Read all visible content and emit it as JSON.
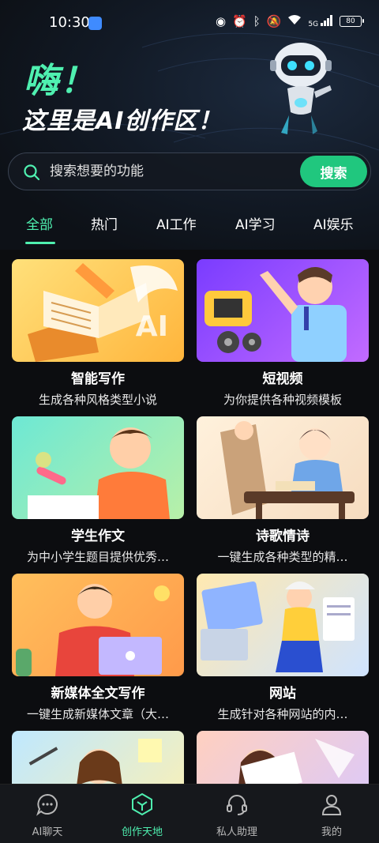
{
  "status_bar": {
    "time": "10:30",
    "network": "5G",
    "battery": "80"
  },
  "hero": {
    "title": "嗨！",
    "subtitle": "这里是AI创作区！"
  },
  "search": {
    "placeholder": "搜索想要的功能",
    "button_label": "搜索"
  },
  "tabs": [
    {
      "label": "全部",
      "active": true
    },
    {
      "label": "热门",
      "active": false
    },
    {
      "label": "AI工作",
      "active": false
    },
    {
      "label": "AI学习",
      "active": false
    },
    {
      "label": "AI娱乐",
      "active": false
    }
  ],
  "cards": [
    {
      "title": "智能写作",
      "desc": "生成各种风格类型小说",
      "badge": "AI"
    },
    {
      "title": "短视频",
      "desc": "为你提供各种视频模板"
    },
    {
      "title": "学生作文",
      "desc": "为中小学生题目提供优秀…"
    },
    {
      "title": "诗歌情诗",
      "desc": "一键生成各种类型的精…"
    },
    {
      "title": "新媒体全文写作",
      "desc": "一键生成新媒体文章（大…"
    },
    {
      "title": "网站",
      "desc": "生成针对各种网站的内…"
    },
    {
      "title": "",
      "desc": ""
    },
    {
      "title": "",
      "desc": ""
    }
  ],
  "bottom_nav": [
    {
      "label": "AI聊天",
      "icon": "chat-icon",
      "active": false
    },
    {
      "label": "创作天地",
      "icon": "cube-icon",
      "active": true
    },
    {
      "label": "私人助理",
      "icon": "headset-icon",
      "active": false
    },
    {
      "label": "我的",
      "icon": "person-icon",
      "active": false
    }
  ],
  "colors": {
    "accent": "#4ff0b0",
    "button": "#20c77e",
    "background": "#0c0d10"
  }
}
